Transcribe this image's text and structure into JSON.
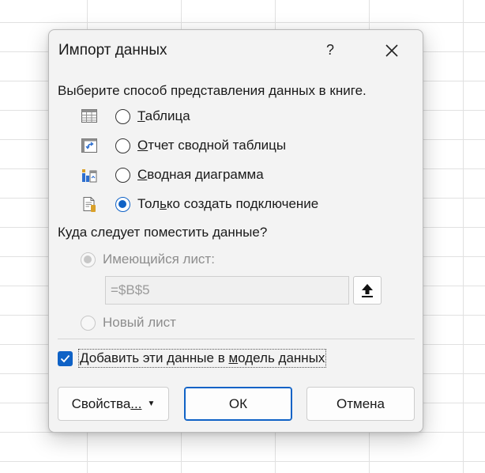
{
  "dialog": {
    "title": "Импорт данных",
    "help_label": "?",
    "close_icon": "close-icon",
    "prompt": "Выберите способ представления данных в книге.",
    "view_options": [
      {
        "icon": "table-icon",
        "underline_char": "Т",
        "rest": "аблица",
        "selected": false
      },
      {
        "icon": "pivot-table-icon",
        "underline_char": "О",
        "rest": "тчет сводной таблицы",
        "selected": false
      },
      {
        "icon": "pivot-chart-icon",
        "underline_char": "С",
        "rest": "водная диаграмма",
        "selected": false
      },
      {
        "icon": "connection-icon",
        "prefix": "Тол",
        "underline_char": "ь",
        "rest": "ко создать подключение",
        "selected": true
      }
    ],
    "location_prompt": "Куда следует поместить данные?",
    "location_options": {
      "existing_sheet": "Имеющийся лист:",
      "new_sheet": "Новый лист"
    },
    "location_value": "=$B$5",
    "collapse_icon": "collapse-upload-icon",
    "data_model": {
      "label_prefix": "Добавить эти данные в ",
      "underline_char": "м",
      "label_rest": "одель данных",
      "checked": true
    },
    "buttons": {
      "properties_prefix": "Свойства",
      "properties_underline": "...",
      "ok": "ОК",
      "cancel": "Отмена"
    }
  },
  "colors": {
    "accent": "#0f62c6",
    "dialog_bg": "#f3f3f3",
    "disabled_text": "#8d8d8d"
  }
}
